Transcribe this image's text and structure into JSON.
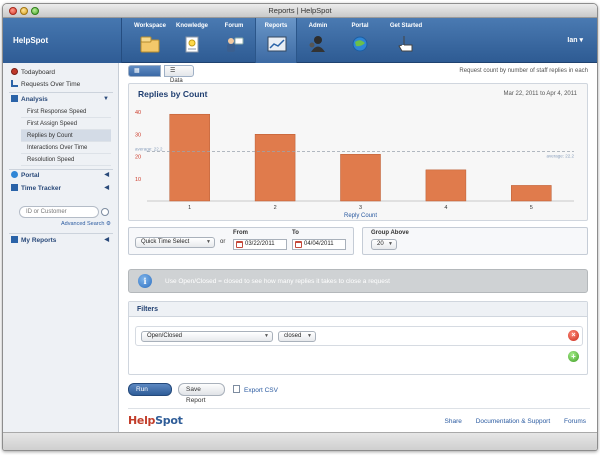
{
  "window": {
    "title": "Reports | HelpSpot"
  },
  "brand": {
    "name": "HelpSpot",
    "logo_help": "Help",
    "logo_spot": "Spot"
  },
  "nav": {
    "tabs": [
      {
        "label": "Workspace",
        "icon": "workspace-icon"
      },
      {
        "label": "Knowledge",
        "icon": "knowledge-icon"
      },
      {
        "label": "Forum",
        "icon": "forum-icon"
      },
      {
        "label": "Reports",
        "icon": "reports-icon",
        "active": true
      },
      {
        "label": "Admin",
        "icon": "admin-icon"
      },
      {
        "label": "Portal",
        "icon": "portal-icon"
      },
      {
        "label": "Get Started",
        "icon": "hand-pointer-icon"
      }
    ],
    "user": "Ian"
  },
  "sidebar": {
    "todayboard": "Todayboard",
    "requests_over_time": "Requests Over Time",
    "analysis": "Analysis",
    "analysis_items": [
      "First Response Speed",
      "First Assign Speed",
      "Replies by Count",
      "Interactions Over Time",
      "Resolution Speed"
    ],
    "active_item": "Replies by Count",
    "portal": "Portal",
    "time_tracker": "Time Tracker",
    "search_placeholder": "ID or Customer",
    "advanced_search": "Advanced Search",
    "my_reports": "My Reports"
  },
  "report": {
    "graph_tab": "Graph",
    "data_tab": "Data",
    "caption": "Request count by number of staff replies in each",
    "chart_title": "Replies by Count",
    "date_range": "Mar 22, 2011  to  Apr  4, 2011",
    "average_left": "average: 22.2",
    "average_right": "average: 22.2"
  },
  "chart_data": {
    "type": "bar",
    "title": "Replies by Count",
    "xlabel": "Reply Count",
    "ylabel": "",
    "categories": [
      "1",
      "2",
      "3",
      "4",
      "5"
    ],
    "values": [
      39,
      30,
      21,
      14,
      7
    ],
    "yticks": [
      10,
      20,
      30,
      40
    ],
    "ylim": [
      0,
      40
    ],
    "average": 22.2,
    "grid": false,
    "bar_color": "#e07b4c"
  },
  "controls": {
    "time_select": "Quick Time Select",
    "or_label": "or",
    "from_label": "From",
    "from_value": "03/22/2011",
    "to_label": "To",
    "to_value": "04/04/2011",
    "group_label": "Group Above",
    "group_value": "20"
  },
  "info": {
    "text": "Use Open/Closed = closed to see how many replies it takes to close a request"
  },
  "filters": {
    "title": "Filters",
    "field": "Open/Closed",
    "value": "closed"
  },
  "actions": {
    "run": "Run Report",
    "save": "Save Report",
    "export": "Export CSV"
  },
  "footer": {
    "share": "Share",
    "docs": "Documentation & Support",
    "forums": "Forums"
  }
}
